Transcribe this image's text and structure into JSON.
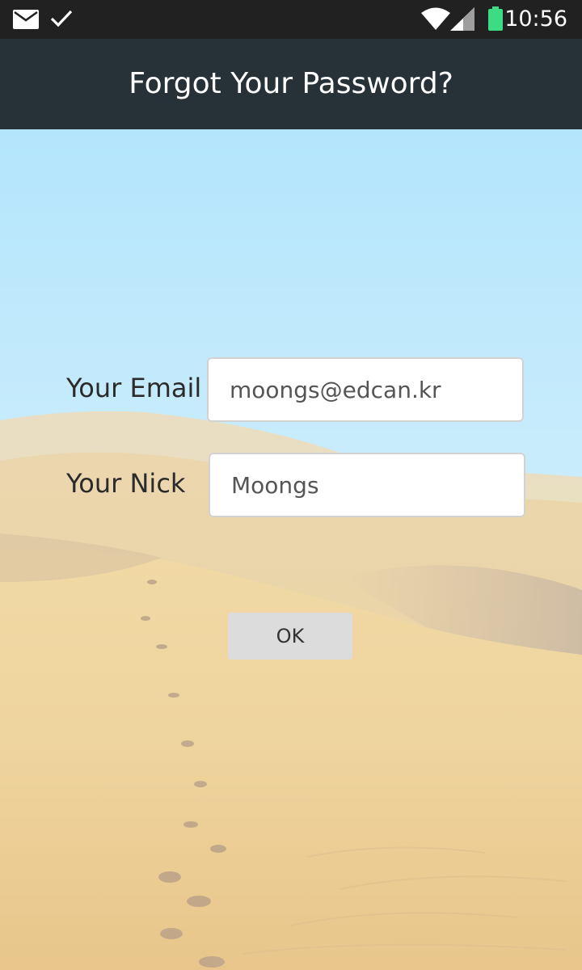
{
  "status_bar": {
    "time": "10:56",
    "icons": [
      "mail-icon",
      "check-icon",
      "wifi-icon",
      "signal-icon",
      "battery-icon"
    ],
    "battery_color": "#3ddc84"
  },
  "toolbar": {
    "title": "Forgot Your Password?",
    "background": "#263238"
  },
  "form": {
    "email_label": "Your Email",
    "email_value": "moongs@edcan.kr",
    "nick_label": "Your Nick",
    "nick_value": "Moongs",
    "ok_label": "OK"
  },
  "colors": {
    "sky_top": "#b3e5fc",
    "sky_bottom": "#e7f6fd",
    "sand": "#efd39b",
    "button_bg": "#dcdcdc"
  }
}
